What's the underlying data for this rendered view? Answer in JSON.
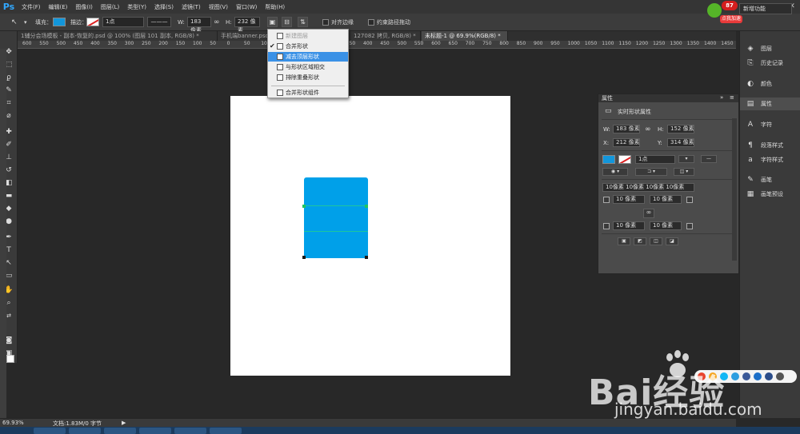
{
  "app": {
    "logo": "Ps"
  },
  "menu": [
    "文件(F)",
    "编辑(E)",
    "图像(I)",
    "图层(L)",
    "类型(Y)",
    "选择(S)",
    "滤镜(T)",
    "视图(V)",
    "窗口(W)",
    "帮助(H)"
  ],
  "options": {
    "fill_label": "填充：",
    "stroke_label": "描边：",
    "stroke_size": "1点",
    "w_label": "W:",
    "w_value": "183 像素",
    "h_label": "H:",
    "h_value": "232 像素",
    "align_edges": "对齐边缘",
    "constrain_path": "约束路径拖动",
    "workspace": "新增功能",
    "fill_color": "#1296db"
  },
  "mascot": {
    "badge": "87",
    "tag": "点我加速"
  },
  "tabs": [
    "1辅分会场模板 - 副本-恢复的.psd @ 100% (图层 101 副本, RGB/8) *",
    "手机端banner.psd",
    "127082 拷贝, RGB/8) *",
    "未标题-1 @ 69.9%(RGB/8) *"
  ],
  "ruler_h": [
    "600",
    "550",
    "500",
    "450",
    "400",
    "350",
    "300",
    "250",
    "200",
    "150",
    "100",
    "50",
    "0",
    "50",
    "100",
    "150",
    "200",
    "250",
    "300",
    "350",
    "400",
    "450",
    "500",
    "550",
    "600",
    "650",
    "700",
    "750",
    "800",
    "850",
    "900",
    "950",
    "1000",
    "1050",
    "1100",
    "1150",
    "1200",
    "1250",
    "1300",
    "1350",
    "1400",
    "1450"
  ],
  "path_menu": {
    "items": [
      {
        "label": "新建图层",
        "state": "disabled"
      },
      {
        "label": "合并形状",
        "state": "checked"
      },
      {
        "label": "减去顶层形状",
        "state": "highlight"
      },
      {
        "label": "与形状区域相交",
        "state": "normal"
      },
      {
        "label": "排除重叠形状",
        "state": "normal"
      },
      {
        "label": "合并形状组件",
        "state": "normal"
      }
    ]
  },
  "properties": {
    "panel_title": "属性",
    "heading": "实时形状属性",
    "w_label": "W:",
    "w_value": "183 像素",
    "h_label": "H:",
    "h_value": "152 像素",
    "x_label": "X:",
    "x_value": "212 像素",
    "y_label": "Y:",
    "y_value": "314 像素",
    "stroke_size": "1点",
    "corner_all": "10像素 10像素 10像素 10像素",
    "corner_tl": "10 像素",
    "corner_tr": "10 像素",
    "corner_bl": "10 像素",
    "corner_br": "10 像素"
  },
  "dock": [
    "图层",
    "历史记录",
    "颜色",
    "属性",
    "字符",
    "段落样式",
    "字符样式",
    "画笔",
    "画笔预设"
  ],
  "status": {
    "zoom": "69.93%",
    "doc": "文档:1.83M/0 字节"
  },
  "watermark": {
    "logo": "Bai经验",
    "url": "jingyan.baidu.com"
  }
}
